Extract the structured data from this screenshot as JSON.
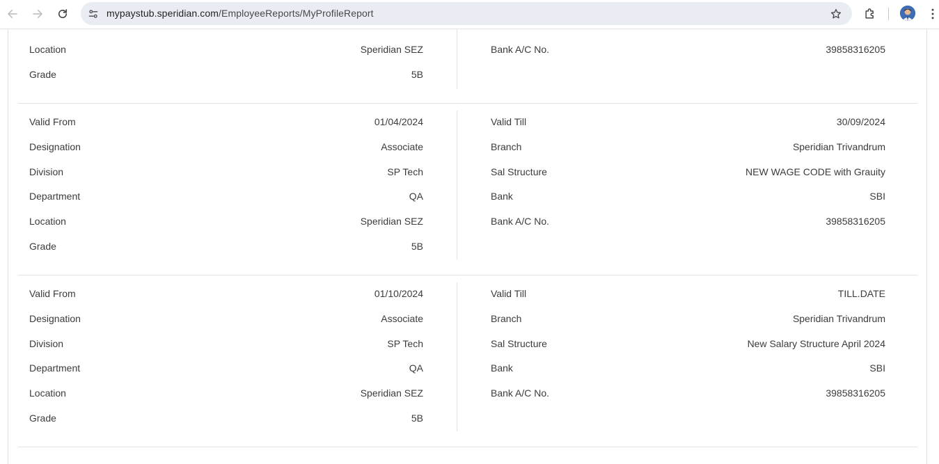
{
  "browser": {
    "url_host": "mypaystub.speridian.com",
    "url_path": "/EmployeeReports/MyProfileReport",
    "icons": {
      "back": "arrow-left-icon",
      "forward": "arrow-right-icon",
      "reload": "reload-icon",
      "site_info": "tune-icon",
      "bookmark": "star-icon",
      "extensions": "puzzle-icon",
      "menu": "kebab-menu-icon",
      "profile": "avatar"
    }
  },
  "records": [
    {
      "left": [
        {
          "label": "Location",
          "value": "Speridian SEZ"
        },
        {
          "label": "Grade",
          "value": "5B"
        }
      ],
      "right": [
        {
          "label": "Bank A/C No.",
          "value": "39858316205"
        }
      ]
    },
    {
      "left": [
        {
          "label": "Valid From",
          "value": "01/04/2024"
        },
        {
          "label": "Designation",
          "value": "Associate"
        },
        {
          "label": "Division",
          "value": "SP Tech"
        },
        {
          "label": "Department",
          "value": "QA"
        },
        {
          "label": "Location",
          "value": "Speridian SEZ"
        },
        {
          "label": "Grade",
          "value": "5B"
        }
      ],
      "right": [
        {
          "label": "Valid Till",
          "value": "30/09/2024"
        },
        {
          "label": "Branch",
          "value": "Speridian Trivandrum"
        },
        {
          "label": "Sal Structure",
          "value": "NEW WAGE CODE with Grauity"
        },
        {
          "label": "Bank",
          "value": "SBI"
        },
        {
          "label": "Bank A/C No.",
          "value": "39858316205"
        }
      ]
    },
    {
      "left": [
        {
          "label": "Valid From",
          "value": "01/10/2024"
        },
        {
          "label": "Designation",
          "value": "Associate"
        },
        {
          "label": "Division",
          "value": "SP Tech"
        },
        {
          "label": "Department",
          "value": "QA"
        },
        {
          "label": "Location",
          "value": "Speridian SEZ"
        },
        {
          "label": "Grade",
          "value": "5B"
        }
      ],
      "right": [
        {
          "label": "Valid Till",
          "value": "TILL.DATE"
        },
        {
          "label": "Branch",
          "value": "Speridian Trivandrum"
        },
        {
          "label": "Sal Structure",
          "value": "New Salary Structure April 2024"
        },
        {
          "label": "Bank",
          "value": "SBI"
        },
        {
          "label": "Bank A/C No.",
          "value": "39858316205"
        }
      ]
    }
  ]
}
